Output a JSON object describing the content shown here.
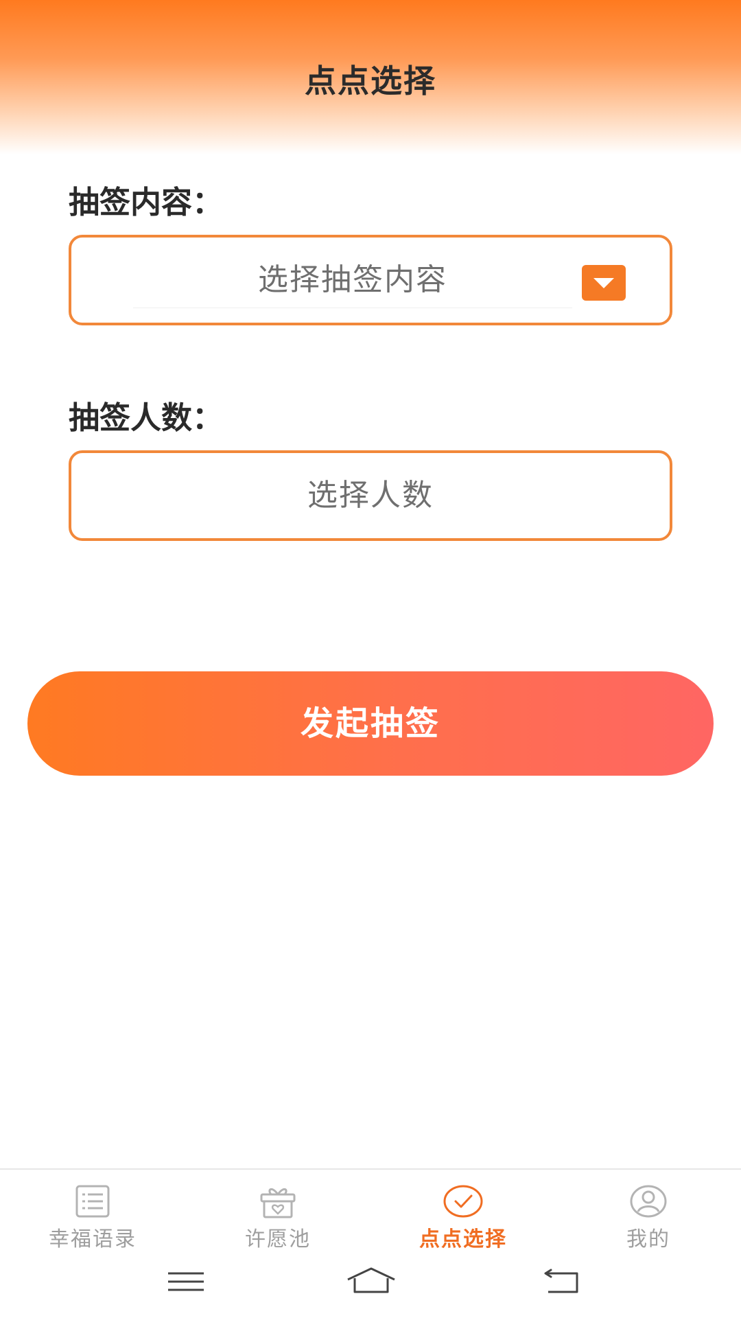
{
  "header": {
    "title": "点点选择"
  },
  "form": {
    "content_label": "抽签内容：",
    "content_placeholder": "选择抽签内容",
    "count_label": "抽签人数：",
    "count_placeholder": "选择人数"
  },
  "actions": {
    "start_label": "发起抽签"
  },
  "tabs": [
    {
      "label": "幸福语录",
      "icon": "list-icon",
      "active": false
    },
    {
      "label": "许愿池",
      "icon": "gift-icon",
      "active": false
    },
    {
      "label": "点点选择",
      "icon": "check-circle-icon",
      "active": true
    },
    {
      "label": "我的",
      "icon": "user-icon",
      "active": false
    }
  ],
  "system_nav": {
    "icons": [
      "menu-icon",
      "home-icon",
      "back-icon"
    ]
  },
  "colors": {
    "accent": "#f57a25",
    "active_tab": "#f06d22",
    "inactive_tab": "#9e9e9e"
  }
}
